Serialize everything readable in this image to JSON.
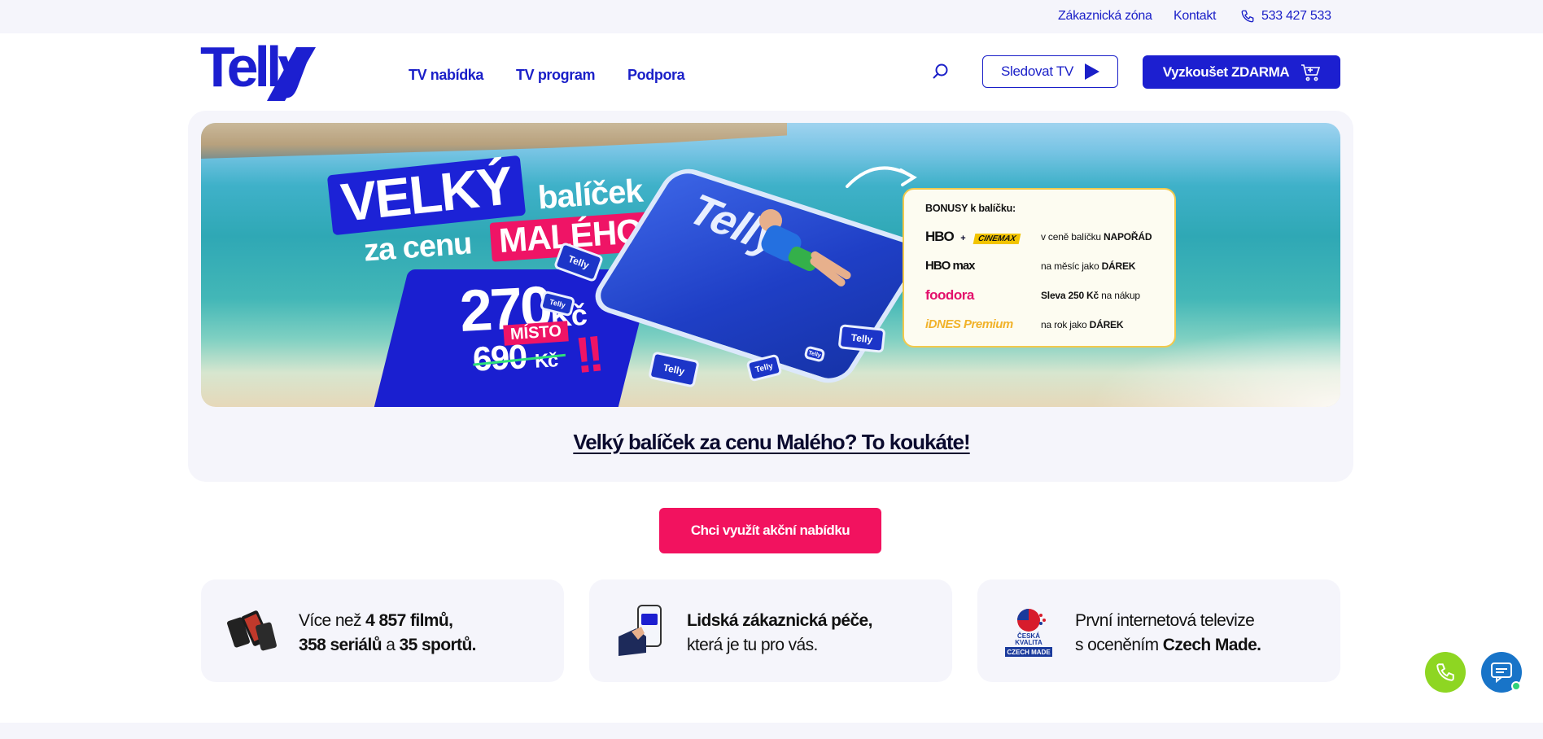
{
  "topbar": {
    "customer_zone": "Zákaznická zóna",
    "contact": "Kontakt",
    "phone": "533 427 533"
  },
  "header": {
    "logo_text": "Telly",
    "nav": [
      "TV nabídka",
      "TV program",
      "Podpora"
    ],
    "watch_label": "Sledovat TV",
    "try_label": "Vyzkoušet ZDARMA"
  },
  "banner": {
    "headline_big": "VELKÝ",
    "headline_balicek": "balíček",
    "headline_zacenu": "za cenu",
    "headline_maleho": "MALÉHO",
    "price_value": "270",
    "price_currency": "Kč",
    "price_misto": "MÍSTO",
    "old_value": "690",
    "old_currency": "Kč",
    "exclaim": "!!",
    "mattress_word": "Telly",
    "cube_label": "Telly",
    "bonus_title": "BONUSY k balíčku:",
    "bonus_rows": [
      {
        "brand": "HBO",
        "brand2": "CINEMAX",
        "plus": "+",
        "text_a": "v ceně balíčku ",
        "text_b": "NAPOŘÁD"
      },
      {
        "brand": "HBO max",
        "text_a": "na měsíc jako ",
        "text_b": "DÁREK"
      },
      {
        "brand": "foodora",
        "text_b": "Sleva 250 Kč",
        "text_a": " na nákup"
      },
      {
        "brand": "iDNES Premium",
        "text_a": "na rok jako ",
        "text_b": "DÁREK"
      }
    ]
  },
  "promo_link": "Velký balíček za cenu Malého? To koukáte!",
  "cta_label": "Chci využít akční nabídku",
  "features": [
    {
      "t1": "Více než ",
      "b1": "4 857 filmů,",
      "b2": "358 seriálů",
      "t2": " a ",
      "b3": "35 sportů."
    },
    {
      "b1": "Lidská zákaznická péče,",
      "t1": "která je tu pro vás."
    },
    {
      "t1": "První internetová televize",
      "t2": "s oceněním ",
      "b1": "Czech Made."
    }
  ],
  "badge": {
    "line1": "ČESKÁ",
    "line2": "KVALITA",
    "line3": "CZECH MADE"
  },
  "colors": {
    "brand_blue": "#1c1fd0",
    "cta_pink": "#f2125f",
    "call_green": "#8ed622",
    "chat_blue": "#1874c8"
  }
}
